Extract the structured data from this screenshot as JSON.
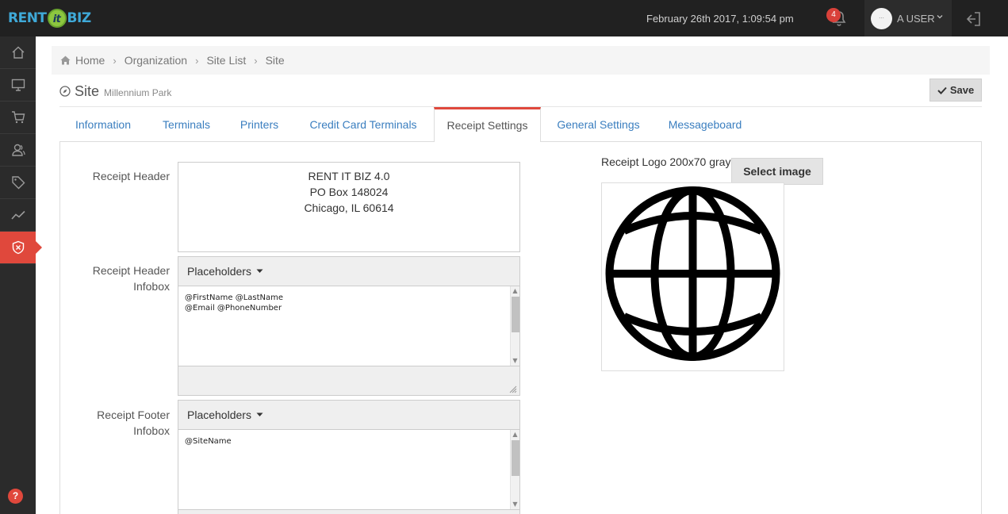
{
  "app": {
    "logo_text_left": "RENT",
    "logo_text_mid": "it",
    "logo_text_right": "BIZ"
  },
  "topbar": {
    "datetime": "February 26th 2017, 1:09:54 pm",
    "notification_count": "4",
    "avatar_text": "...",
    "username": "A USER",
    "icons": {
      "bell": "bell-icon",
      "logout": "logout-icon",
      "caret": "chevron-down-icon"
    }
  },
  "sidebar": {
    "items": [
      {
        "icon": "home-icon"
      },
      {
        "icon": "monitor-icon"
      },
      {
        "icon": "cart-icon"
      },
      {
        "icon": "users-icon"
      },
      {
        "icon": "tag-icon"
      },
      {
        "icon": "chart-line-icon"
      },
      {
        "icon": "shield-icon",
        "active": true
      }
    ],
    "help_label": "?"
  },
  "breadcrumb": [
    "Home",
    "Organization",
    "Site List",
    "Site"
  ],
  "page": {
    "title": "Site",
    "subtitle": "Millennium Park",
    "save_label": "Save"
  },
  "tabs": [
    {
      "label": "Information"
    },
    {
      "label": "Terminals"
    },
    {
      "label": "Printers"
    },
    {
      "label": "Credit Card Terminals"
    },
    {
      "label": "Receipt Settings",
      "active": true
    },
    {
      "label": "General Settings"
    },
    {
      "label": "Messageboard"
    }
  ],
  "receipt": {
    "header_label": "Receipt Header",
    "header_lines": [
      "RENT IT BIZ 4.0",
      "PO Box 148024",
      "Chicago, IL 60614"
    ],
    "header_infobox_label_1": "Receipt Header",
    "header_infobox_label_2": "Infobox",
    "header_infobox_placeholders": "Placeholders",
    "header_infobox_lines": [
      "@FirstName @LastName",
      "@Email @PhoneNumber"
    ],
    "footer_infobox_label_1": "Receipt Footer",
    "footer_infobox_label_2": "Infobox",
    "footer_infobox_placeholders": "Placeholders",
    "footer_infobox_lines": [
      "@SiteName"
    ],
    "logo_label": "Receipt Logo 200x70 gray",
    "select_image_label": "Select image"
  },
  "colors": {
    "accent": "#e0483c",
    "link": "#3a7ebf",
    "topbar": "#212121",
    "sidebar": "#2b2b2b"
  }
}
